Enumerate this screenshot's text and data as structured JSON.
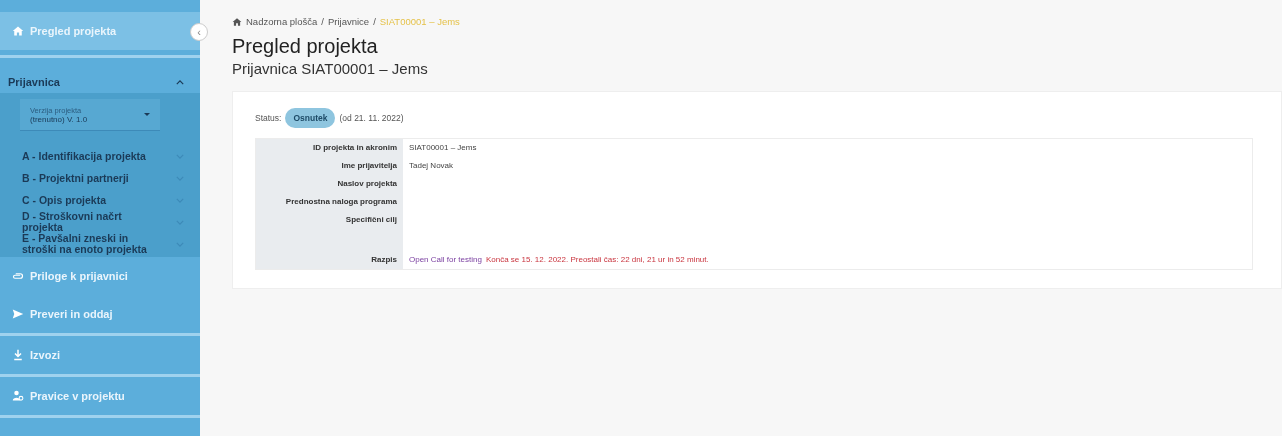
{
  "sidebar": {
    "collapse_button": "‹",
    "items": [
      {
        "kind": "link",
        "label": "Pregled projekta",
        "selected": true,
        "divider": false
      },
      {
        "kind": "group",
        "label": "Prijavnica",
        "expanded": true,
        "version_select": {
          "label": "Verzija projekta",
          "value": "(trenutno) V. 1.0"
        },
        "children": [
          {
            "label": "A - Identifikacija projekta",
            "expanded": false
          },
          {
            "label": "B - Projektni partnerji",
            "expanded": false
          },
          {
            "label": "C - Opis projekta",
            "expanded": false
          },
          {
            "label": "D - Stroškovni načrt projekta",
            "expanded": false
          },
          {
            "label": "E - Pavšalni zneski in stroški na enoto projekta",
            "expanded": false
          }
        ]
      },
      {
        "kind": "link",
        "label": "Priloge k prijavnici",
        "selected": false,
        "divider": false
      },
      {
        "kind": "link",
        "label": "Preveri in oddaj",
        "selected": false,
        "divider": true
      },
      {
        "kind": "link",
        "label": "Izvozi",
        "selected": false,
        "divider": true
      },
      {
        "kind": "link",
        "label": "Pravice v projektu",
        "selected": false,
        "divider": true
      }
    ]
  },
  "breadcrumb": [
    {
      "label": "Nadzorna plošča",
      "current": false
    },
    {
      "separator": "/",
      "label": "Prijavnice",
      "current": false
    },
    {
      "separator": "/",
      "label": "SIAT00001 – Jems",
      "current": true
    }
  ],
  "title": "Pregled projekta",
  "subtitle": "Prijavnica SIAT00001 – Jems",
  "status": {
    "label": "Status:",
    "badge": "Osnutek",
    "since": "(od 21. 11. 2022)"
  },
  "table": {
    "rows": [
      {
        "kind": "text",
        "label": "ID projekta in akronim",
        "value": "SIAT00001 – Jems"
      },
      {
        "kind": "text",
        "label": "Ime prijavitelja",
        "value": "Tadej Novak"
      },
      {
        "kind": "text",
        "label": "Naslov projekta"
      },
      {
        "kind": "text",
        "label": "Prednostna naloga programa"
      },
      {
        "kind": "text",
        "label": "Specifični cilj"
      },
      {
        "kind": "call",
        "label": "Razpis",
        "link": "Open Call for testing",
        "note": "Konča se 15. 12. 2022. Preostali čas: 22 dni, 21 ur in 52 minut."
      }
    ]
  }
}
